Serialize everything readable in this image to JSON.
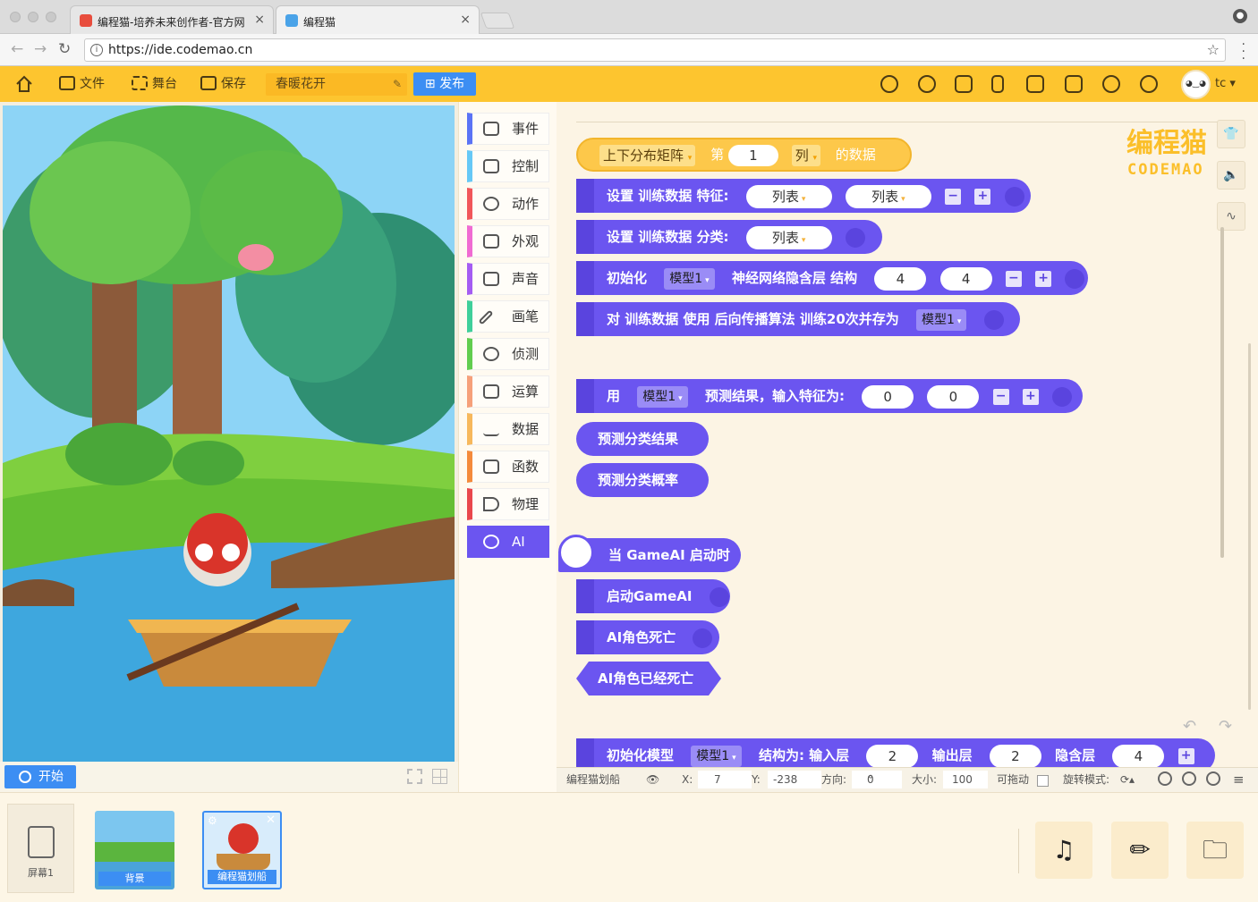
{
  "browser": {
    "tabs": [
      {
        "title": "编程猫-培养未来创作者-官方网",
        "active": false
      },
      {
        "title": "编程猫",
        "active": true
      }
    ],
    "url": "https://ide.codemao.cn"
  },
  "toolbar": {
    "file_label": "文件",
    "stage_label": "舞台",
    "save_label": "保存",
    "project_name": "春暖花开",
    "publish_label": "发布",
    "user_name": "tc"
  },
  "stage": {
    "start_label": "开始"
  },
  "categories": [
    {
      "label": "事件",
      "color": "#5b73f5"
    },
    {
      "label": "控制",
      "color": "#66c8f6"
    },
    {
      "label": "动作",
      "color": "#f1565a"
    },
    {
      "label": "外观",
      "color": "#f06bd2"
    },
    {
      "label": "声音",
      "color": "#a45cf2"
    },
    {
      "label": "画笔",
      "color": "#3fcf9a"
    },
    {
      "label": "侦测",
      "color": "#61cd4f"
    },
    {
      "label": "运算",
      "color": "#f6a07a"
    },
    {
      "label": "数据",
      "color": "#f7b85c"
    },
    {
      "label": "函数",
      "color": "#f48a3b"
    },
    {
      "label": "物理",
      "color": "#e9474c"
    },
    {
      "label": "AI",
      "color": "#6b55f0"
    }
  ],
  "blocks": {
    "b0": {
      "t1": "上下分布矩阵",
      "t2": "第",
      "v1": "1",
      "t3": "列",
      "t4": "的数据"
    },
    "b1": {
      "t1": "设置 训练数据 特征:",
      "p1": "列表",
      "p2": "列表"
    },
    "b2": {
      "t1": "设置 训练数据 分类:",
      "p1": "列表"
    },
    "b3": {
      "t1": "初始化",
      "d1": "模型1",
      "t2": "神经网络隐含层 结构",
      "v1": "4",
      "v2": "4"
    },
    "b4": {
      "t1": "对 训练数据 使用 后向传播算法 训练20次并存为",
      "d1": "模型1"
    },
    "b5": {
      "t1": "用",
      "d1": "模型1",
      "t2": "预测结果，输入特征为:",
      "v1": "0",
      "v2": "0"
    },
    "b6": {
      "t1": "预测分类结果"
    },
    "b7": {
      "t1": "预测分类概率"
    },
    "b8": {
      "t1": "当 GameAI 启动时"
    },
    "b9": {
      "t1": "启动GameAI"
    },
    "b10": {
      "t1": "AI角色死亡"
    },
    "b11": {
      "t1": "AI角色已经死亡"
    },
    "b12": {
      "t1": "初始化模型",
      "d1": "模型1",
      "t2": "结构为: 输入层",
      "v1": "2",
      "t3": "输出层",
      "v2": "2",
      "t4": "隐含层",
      "v3": "4"
    }
  },
  "logo": {
    "cn": "编程猫",
    "en": "CODEMAO"
  },
  "props": {
    "sprite_name": "编程猫划船",
    "x_label": "X:",
    "x_value": "7",
    "y_label": "Y:",
    "y_value": "-238",
    "dir_label": "方向:",
    "dir_value": "0",
    "size_label": "大小:",
    "size_value": "100",
    "drag_label": "可拖动",
    "rotate_label": "旋转模式:"
  },
  "bottom": {
    "screen_label": "屏幕1",
    "sprites": [
      "背景",
      "编程猫划船"
    ]
  }
}
